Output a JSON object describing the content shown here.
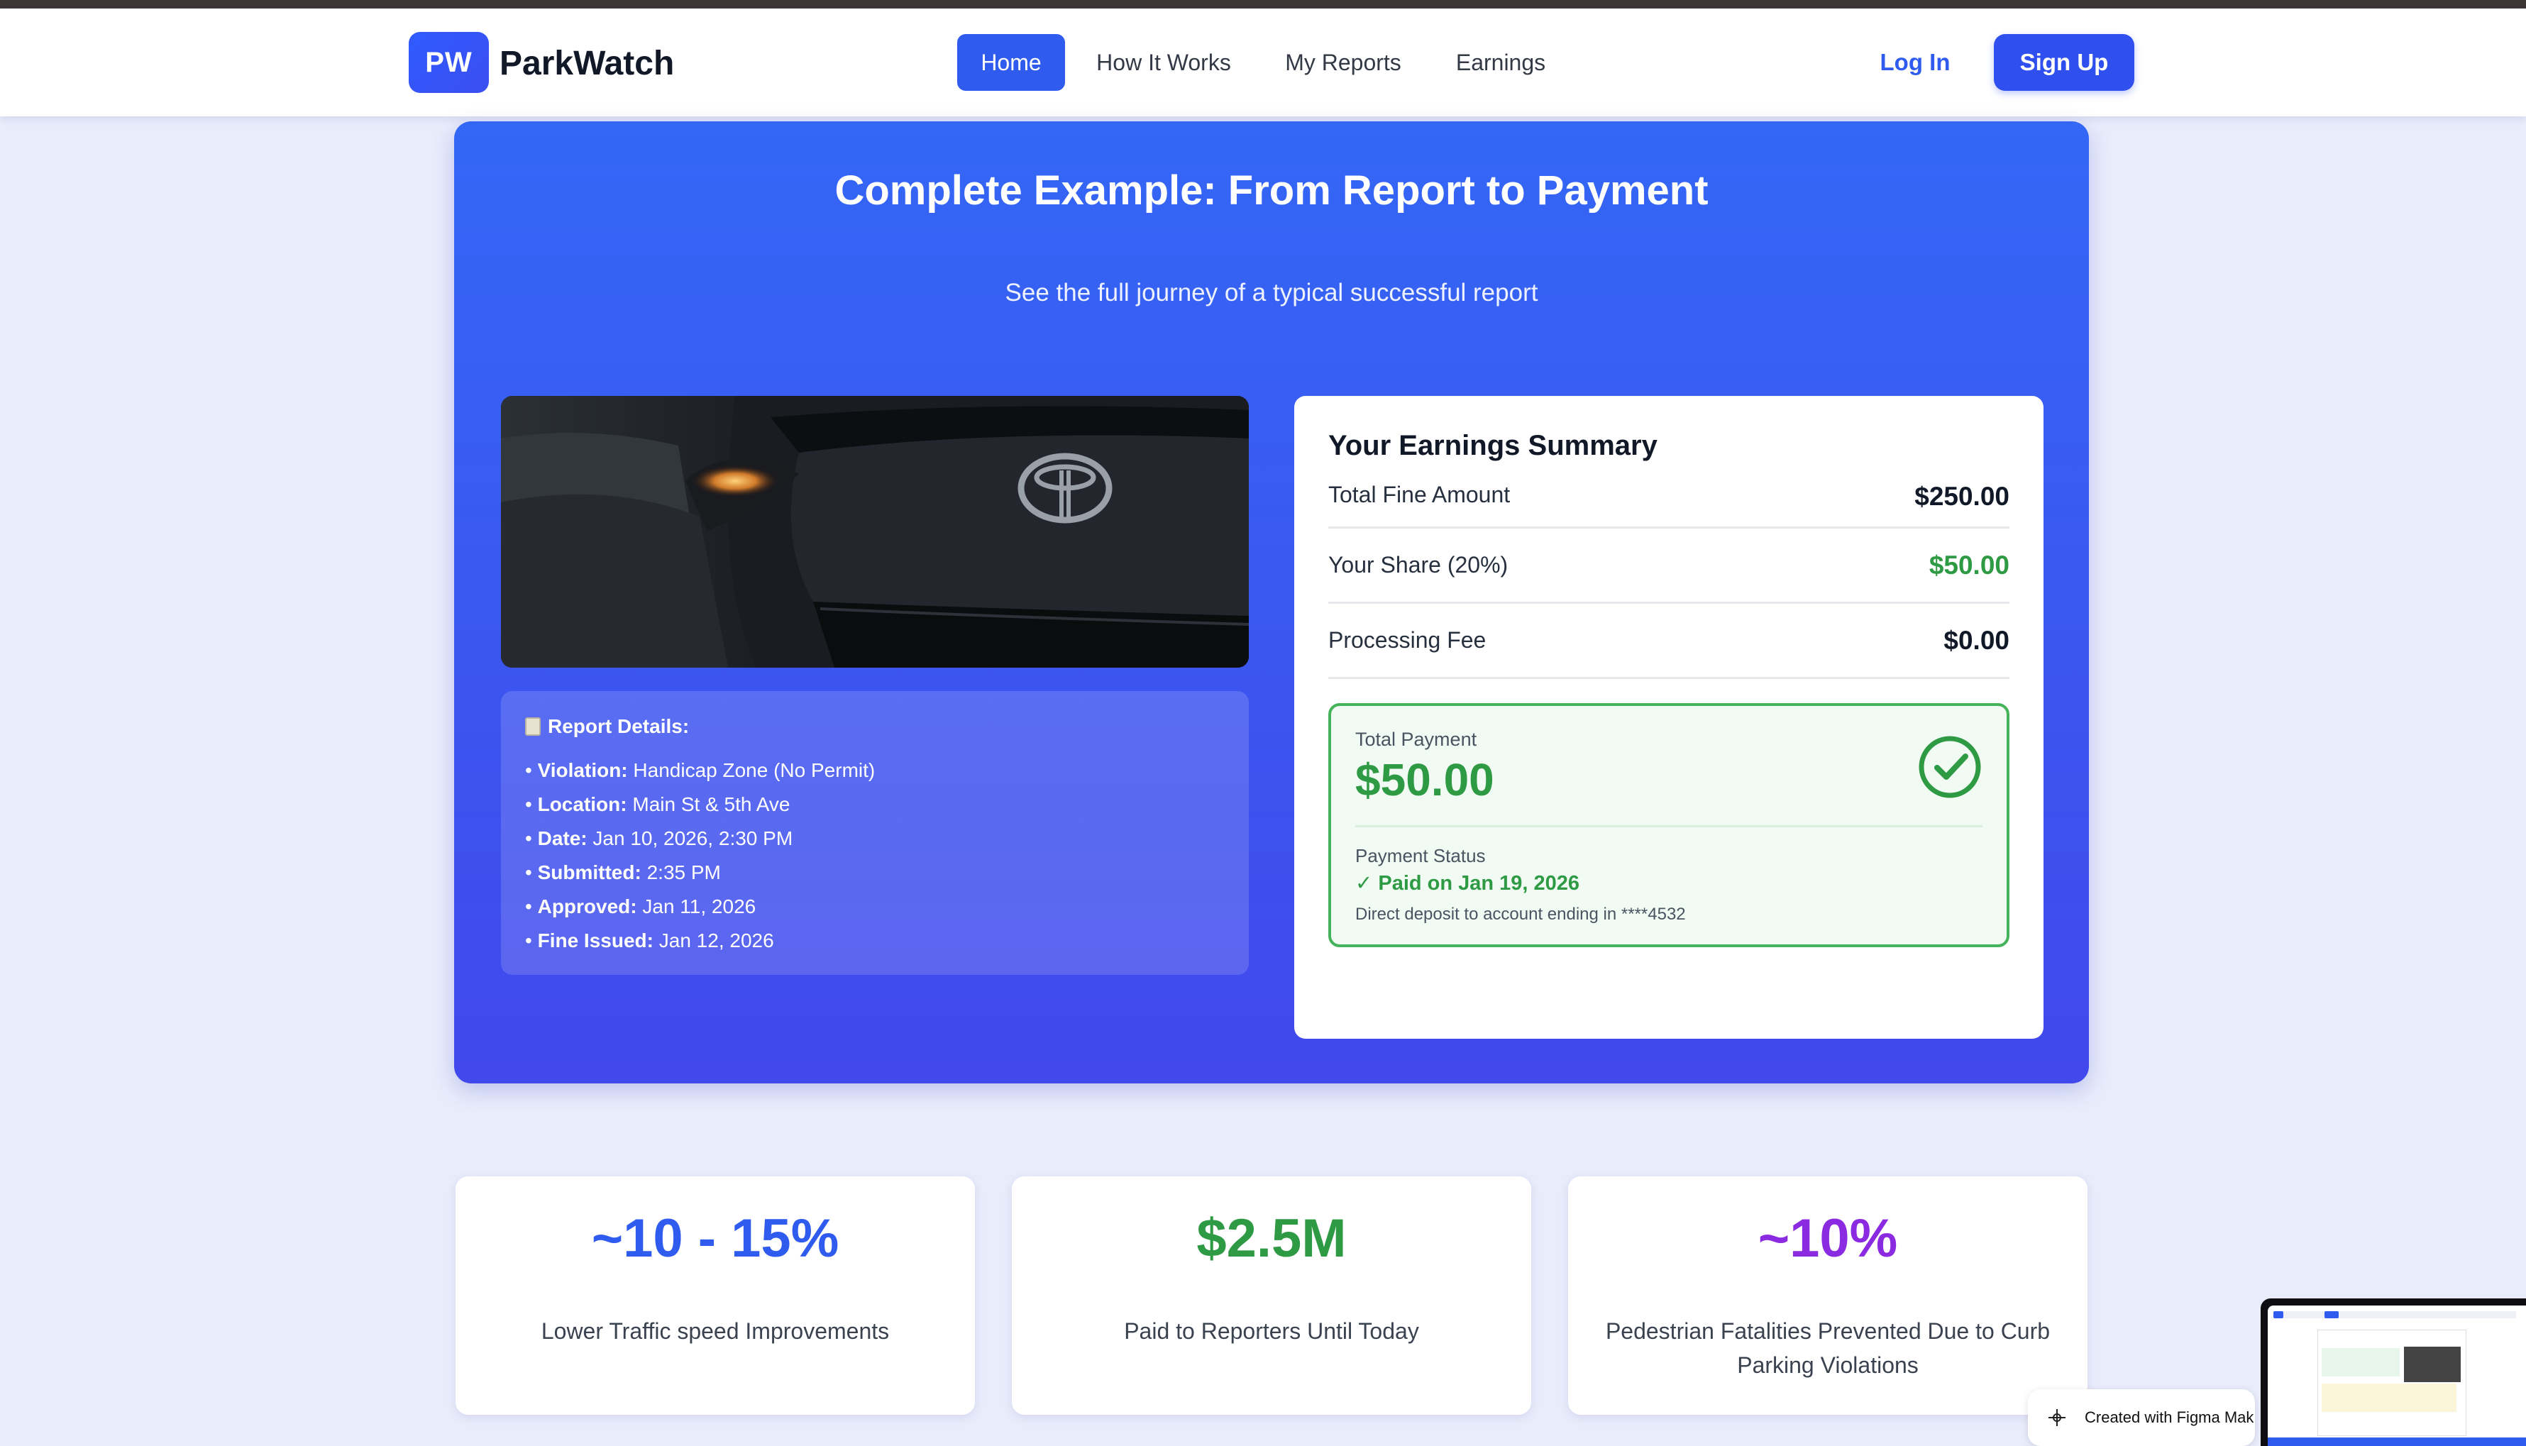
{
  "nav": {
    "logo": "PW",
    "brand": "ParkWatch",
    "items": [
      {
        "label": "Home",
        "active": true
      },
      {
        "label": "How It Works",
        "active": false
      },
      {
        "label": "My Reports",
        "active": false
      },
      {
        "label": "Earnings",
        "active": false
      }
    ],
    "login": "Log In",
    "signup": "Sign Up"
  },
  "hero": {
    "title": "Complete Example: From Report to Payment",
    "subtitle": "See the full journey of a typical successful report"
  },
  "report": {
    "heading": "Report Details:",
    "rows": [
      {
        "label": "Violation:",
        "value": "Handicap Zone (No Permit)"
      },
      {
        "label": "Location:",
        "value": "Main St & 5th Ave"
      },
      {
        "label": "Date:",
        "value": "Jan 10, 2026, 2:30 PM"
      },
      {
        "label": "Submitted:",
        "value": "2:35 PM"
      },
      {
        "label": "Approved:",
        "value": "Jan 11, 2026"
      },
      {
        "label": "Fine Issued:",
        "value": "Jan 12, 2026"
      }
    ]
  },
  "summary": {
    "title": "Your Earnings Summary",
    "rows": [
      {
        "label": "Total Fine Amount",
        "value": "$250.00"
      },
      {
        "label": "Your Share (20%)",
        "value": "$50.00"
      },
      {
        "label": "Processing Fee",
        "value": "$0.00"
      }
    ],
    "total_label": "Total Payment",
    "total_value": "$50.00",
    "status_label": "Payment Status",
    "status_value": "✓ Paid on Jan 19, 2026",
    "deposit_note": "Direct deposit to account ending in ****4532"
  },
  "stats": [
    {
      "value": "~10 - 15%",
      "label": "Lower Traffic speed Improvements",
      "color": "#2f5bef"
    },
    {
      "value": "$2.5M",
      "label": "Paid to Reporters Until Today",
      "color": "#2f9a44"
    },
    {
      "value": "~10%",
      "label": "Pedestrian Fatalities Prevented Due to Curb Parking Violations",
      "color": "#8a2be2"
    }
  ],
  "figma_badge": "Created with Figma Mak"
}
